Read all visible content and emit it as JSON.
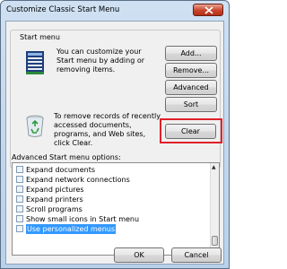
{
  "window": {
    "title": "Customize Classic Start Menu"
  },
  "start_menu_group": {
    "label": "Start menu",
    "description": "You can customize your Start menu by adding or removing items.",
    "clear_description": "To remove records of recently accessed documents, programs, and Web sites, click Clear.",
    "icons": [
      "start-menu-icon",
      "recycle-bin-icon"
    ]
  },
  "buttons": {
    "add": "Add...",
    "remove": "Remove...",
    "advanced": "Advanced",
    "sort": "Sort",
    "clear": "Clear",
    "ok": "OK",
    "cancel": "Cancel"
  },
  "advanced": {
    "label": "Advanced Start menu options:",
    "items": [
      {
        "label": "Expand documents",
        "checked": false
      },
      {
        "label": "Expand network connections",
        "checked": false
      },
      {
        "label": "Expand pictures",
        "checked": false
      },
      {
        "label": "Expand printers",
        "checked": false
      },
      {
        "label": "Scroll programs",
        "checked": false
      },
      {
        "label": "Show small icons in Start menu",
        "checked": false
      },
      {
        "label": "Use personalized menus",
        "checked": false,
        "selected": true
      }
    ]
  },
  "colors": {
    "highlight": "#e0202a",
    "selection": "#3399ff"
  }
}
